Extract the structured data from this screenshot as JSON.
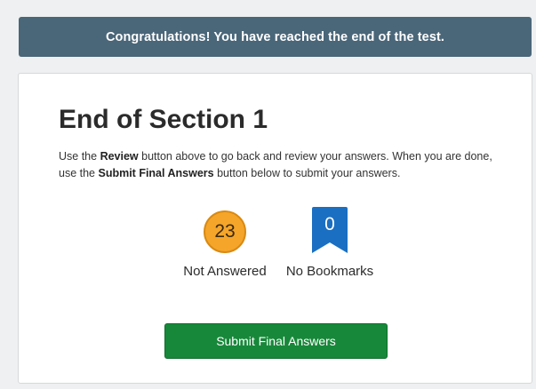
{
  "banner": {
    "message": "Congratulations! You have reached the end of the test."
  },
  "section": {
    "title": "End of Section 1",
    "instructions": {
      "part1": "Use the ",
      "review_label": "Review",
      "part2": " button above to go back and review your answers. When you are done, use the ",
      "submit_label": "Submit Final Answers",
      "part3": " button below to submit your answers."
    }
  },
  "stats": {
    "not_answered": {
      "count": "23",
      "label": "Not Answered",
      "color": "#f5a52a"
    },
    "bookmarks": {
      "count": "0",
      "label": "No Bookmarks",
      "color": "#1a6fc2"
    }
  },
  "actions": {
    "submit_label": "Submit Final Answers",
    "submit_color": "#17883a"
  },
  "colors": {
    "banner_bg": "#4a6679",
    "page_bg": "#eef0f1"
  }
}
